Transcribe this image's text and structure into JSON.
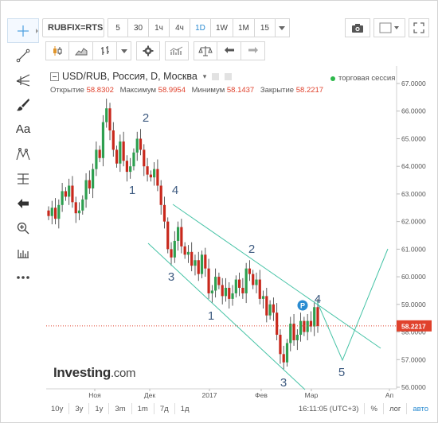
{
  "toolbar": {
    "symbol": "RUBFIX=RTS",
    "timeframes": [
      "5",
      "30",
      "1ч",
      "4ч",
      "1D",
      "1W",
      "1M",
      "15"
    ],
    "active_timeframe": "1D"
  },
  "legend": {
    "title": "USD/RUB, Россия, D, Москва",
    "open_label": "Открытие",
    "open_value": "58.8302",
    "high_label": "Максимум",
    "high_value": "58.9954",
    "low_label": "Минимум",
    "low_value": "58.1437",
    "close_label": "Закрытие",
    "close_value": "58.2217",
    "session_label": "торговая сессия"
  },
  "sidebar": {
    "text_tool": "Aa"
  },
  "logo": {
    "main": "Investing",
    "suffix": ".com"
  },
  "price_axis": {
    "ticks": [
      "67.0000",
      "66.0000",
      "65.0000",
      "64.0000",
      "63.0000",
      "62.0000",
      "61.0000",
      "60.0000",
      "59.0000",
      "58.0000",
      "57.0000",
      "56.0000"
    ],
    "current_price": "58.2217",
    "current_color": "#e0412c"
  },
  "time_axis": {
    "ticks": [
      "Ноя",
      "Дек",
      "2017",
      "Фев",
      "Мар",
      "Ап"
    ]
  },
  "wave_labels": [
    "1",
    "2",
    "3",
    "4",
    "1",
    "2",
    "3",
    "4",
    "5"
  ],
  "badge": "P",
  "bottombar": {
    "ranges": [
      "10y",
      "3y",
      "1y",
      "3m",
      "1m",
      "7д",
      "1д"
    ],
    "time": "16:11:05 (UTC+3)",
    "percent": "%",
    "log": "лог",
    "auto": "авто"
  },
  "colors": {
    "up": "#2e9f50",
    "down": "#c8281c",
    "trend": "#46c3a6",
    "wave_label": "#3d5a80"
  }
}
